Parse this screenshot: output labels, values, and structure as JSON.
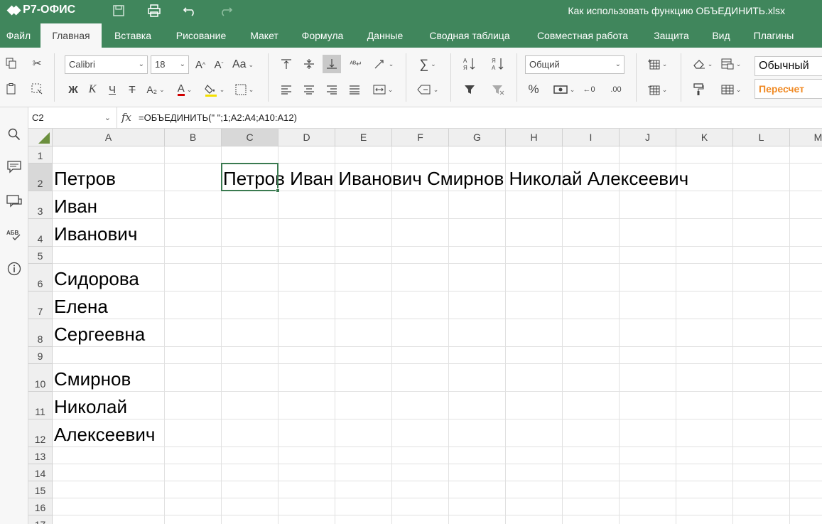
{
  "app": {
    "logo_text": "Р7-ОФИС",
    "doc_title": "Как использовать функцию ОБЪЕДИНИТЬ.xlsx",
    "accent": "#40865c"
  },
  "menu": {
    "tabs": [
      {
        "label": "Файл",
        "active": false
      },
      {
        "label": "Главная",
        "active": true
      },
      {
        "label": "Вставка",
        "active": false
      },
      {
        "label": "Рисование",
        "active": false
      },
      {
        "label": "Макет",
        "active": false
      },
      {
        "label": "Формула",
        "active": false
      },
      {
        "label": "Данные",
        "active": false
      },
      {
        "label": "Сводная таблица",
        "active": false
      },
      {
        "label": "Совместная работа",
        "active": false
      },
      {
        "label": "Защита",
        "active": false
      },
      {
        "label": "Вид",
        "active": false
      },
      {
        "label": "Плагины",
        "active": false
      }
    ]
  },
  "ribbon": {
    "font_name": "Calibri",
    "font_size": "18",
    "bold_label": "Ж",
    "italic_label": "К",
    "underline_label": "Ч",
    "strike_label": "Т",
    "subscript_label": "A₂",
    "font_color_label": "A",
    "case_label": "Aa",
    "number_format": "Общий",
    "percent_label": "%",
    "dec_decrease_label": "←0",
    "dec_increase_label": ".00",
    "style_normal": "Обычный",
    "style_recalc": "Пересчет"
  },
  "formula_bar": {
    "cell_ref": "C2",
    "fx_label": "fx",
    "formula": "=ОБЪЕДИНИТЬ(\" \";1;A2:A4;A10:A12)"
  },
  "sheet": {
    "columns": [
      "A",
      "B",
      "C",
      "D",
      "E",
      "F",
      "G",
      "H",
      "I",
      "J",
      "K",
      "L",
      "M"
    ],
    "rows": [
      "1",
      "2",
      "3",
      "4",
      "5",
      "6",
      "7",
      "8",
      "9",
      "10",
      "11",
      "12",
      "13",
      "14",
      "15",
      "16",
      "17"
    ],
    "selected_cell": "C2",
    "cells": {
      "A2": "Петров",
      "A3": "Иван",
      "A4": "Иванович",
      "A6": "Сидорова",
      "A7": "Елена",
      "A8": "Сергеевна",
      "A10": "Смирнов",
      "A11": "Николай",
      "A12": "Алексеевич",
      "C2": "Петров Иван Иванович Смирнов Николай Алексеевич"
    }
  }
}
